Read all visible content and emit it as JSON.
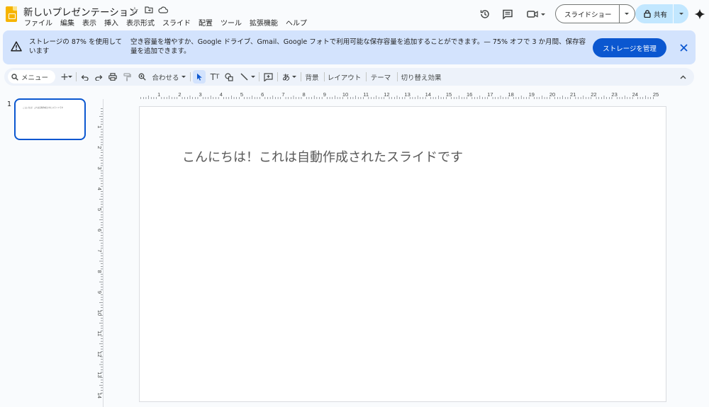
{
  "header": {
    "title": "新しいプレゼンテーション",
    "menu": [
      "ファイル",
      "編集",
      "表示",
      "挿入",
      "表示形式",
      "スライド",
      "配置",
      "ツール",
      "拡張機能",
      "ヘルプ"
    ],
    "slideshow_label": "スライドショー",
    "share_label": "共有"
  },
  "banner": {
    "left_text": "ストレージの 87% を使用しています",
    "main_text": "空き容量を増やすか、Google ドライブ、Gmail、Google フォトで利用可能な保存容量を追加することができます。— 75% オフで 3 か月間、保存容量を追加できます。",
    "button_label": "ストレージを管理"
  },
  "toolbar": {
    "search_label": "メニュー",
    "zoom_label": "合わせる",
    "input_label": "あ",
    "background_label": "背景",
    "layout_label": "レイアウト",
    "theme_label": "テーマ",
    "transition_label": "切り替え効果"
  },
  "filmstrip": {
    "slide_number": "1"
  },
  "slide": {
    "title": "こんにちは！これは自動作成されたスライドです"
  },
  "colors": {
    "accent": "#0b57d0",
    "banner_bg": "#d3e3fd",
    "share_bg": "#c2e7ff",
    "toolbar_bg": "#edf2fa"
  }
}
